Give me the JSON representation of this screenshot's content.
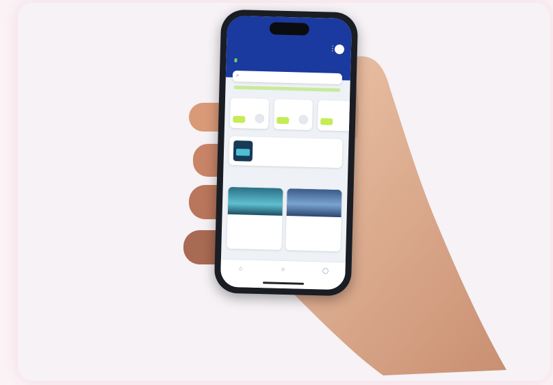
{
  "colors": {
    "background": "#fbf3f6",
    "card": "#f6f2f6",
    "app_header": "#1b3aa0",
    "accent_green": "#c6ec55",
    "skin": "#e8b89a"
  },
  "phone": {
    "status": {
      "time": "",
      "icons": ""
    },
    "header": {
      "title": "",
      "welcome": "",
      "welcome_highlight": ""
    },
    "search": {
      "placeholder": ""
    },
    "category_cards": [
      "",
      "",
      ""
    ],
    "featured": {
      "title": "",
      "subtitle": ""
    },
    "section": {
      "title": "",
      "link": ""
    },
    "boats": [
      {
        "name": "",
        "info": ""
      },
      {
        "name": "",
        "info": ""
      }
    ],
    "tabs": [
      {
        "icon": "home-icon",
        "label": ""
      },
      {
        "icon": "star-icon",
        "label": ""
      },
      {
        "icon": "user-icon",
        "label": ""
      }
    ]
  }
}
